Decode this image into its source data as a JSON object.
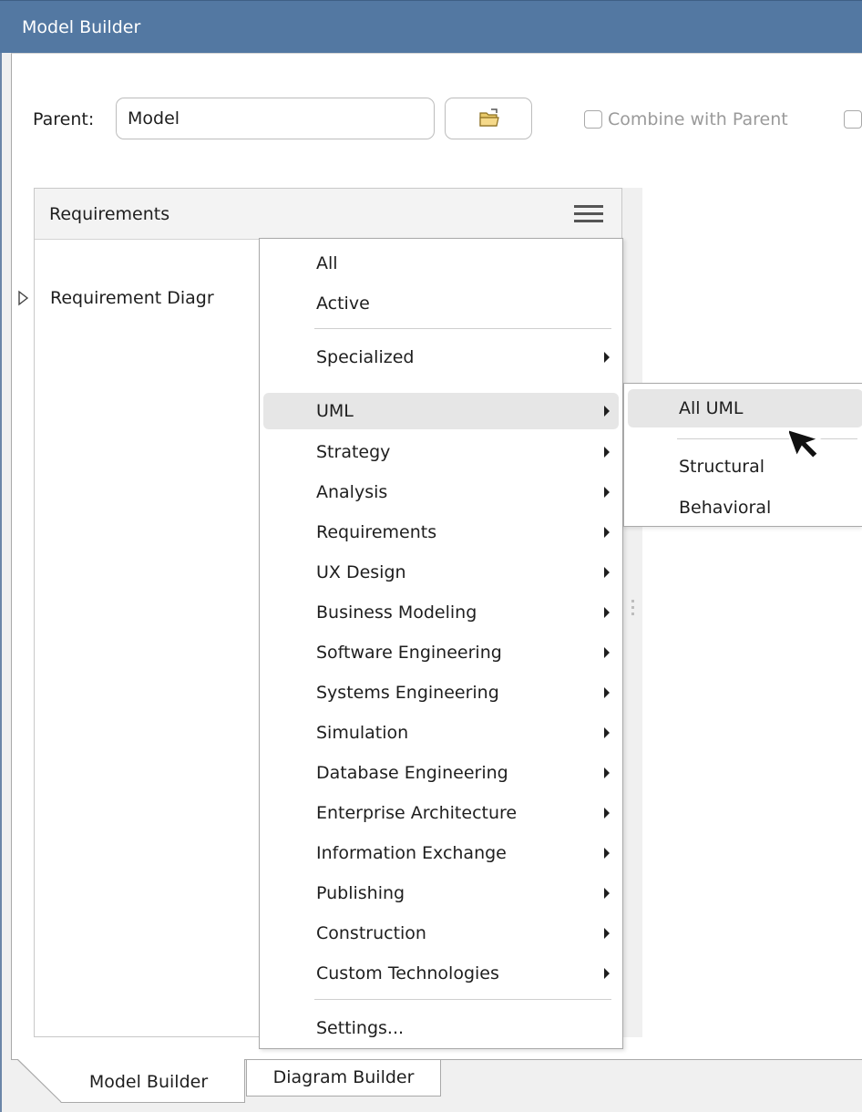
{
  "window": {
    "title": "Model Builder"
  },
  "form": {
    "parent_label": "Parent:",
    "parent_value": "Model",
    "combine_label": "Combine with Parent"
  },
  "panel": {
    "title": "Requirements",
    "tree_item": "Requirement Diagr"
  },
  "menu": {
    "items": [
      {
        "label": "All",
        "submenu": false
      },
      {
        "label": "Active",
        "submenu": false
      },
      {
        "label": "Specialized",
        "submenu": true
      },
      {
        "label": "UML",
        "submenu": true,
        "highlighted": true
      },
      {
        "label": "Strategy",
        "submenu": true
      },
      {
        "label": "Analysis",
        "submenu": true
      },
      {
        "label": "Requirements",
        "submenu": true
      },
      {
        "label": "UX Design",
        "submenu": true
      },
      {
        "label": "Business Modeling",
        "submenu": true
      },
      {
        "label": "Software Engineering",
        "submenu": true
      },
      {
        "label": "Systems Engineering",
        "submenu": true
      },
      {
        "label": "Simulation",
        "submenu": true
      },
      {
        "label": "Database Engineering",
        "submenu": true
      },
      {
        "label": "Enterprise Architecture",
        "submenu": true
      },
      {
        "label": "Information Exchange",
        "submenu": true
      },
      {
        "label": "Publishing",
        "submenu": true
      },
      {
        "label": "Construction",
        "submenu": true
      },
      {
        "label": "Custom Technologies",
        "submenu": true
      },
      {
        "label": "Settings...",
        "submenu": false
      }
    ]
  },
  "submenu": {
    "items": [
      {
        "label": "All UML",
        "highlighted": true
      },
      {
        "label": "Structural"
      },
      {
        "label": "Behavioral"
      }
    ]
  },
  "tabs": [
    {
      "label": "Model Builder",
      "active": true
    },
    {
      "label": "Diagram Builder",
      "active": false
    }
  ],
  "icons": {
    "browse": "folder-open-icon",
    "menu": "hamburger-menu-icon",
    "expand": "expand-triangle-icon",
    "cursor": "mouse-pointer-icon"
  },
  "colors": {
    "titlebar": "#5378a2",
    "highlight": "#e6e6e6"
  }
}
